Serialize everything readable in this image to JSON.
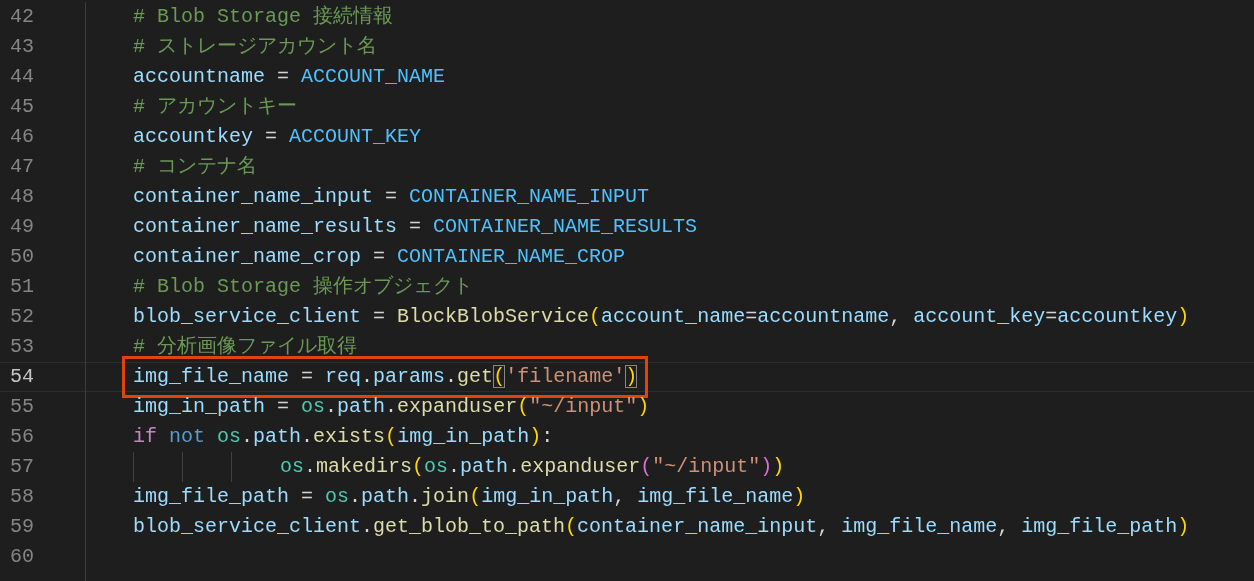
{
  "editor": {
    "lines": [
      {
        "number": "42",
        "current": false,
        "boxed": false,
        "continuation": false,
        "tokens": [
          {
            "kind": "comment",
            "text": "# Blob Storage 接続情報"
          }
        ]
      },
      {
        "number": "43",
        "current": false,
        "boxed": false,
        "continuation": false,
        "tokens": [
          {
            "kind": "comment",
            "text": "# ストレージアカウント名"
          }
        ]
      },
      {
        "number": "44",
        "current": false,
        "boxed": false,
        "continuation": false,
        "tokens": [
          {
            "kind": "var",
            "text": "accountname"
          },
          {
            "kind": "op",
            "text": " = "
          },
          {
            "kind": "const",
            "text": "ACCOUNT_NAME"
          }
        ]
      },
      {
        "number": "45",
        "current": false,
        "boxed": false,
        "continuation": false,
        "tokens": [
          {
            "kind": "comment",
            "text": "# アカウントキー"
          }
        ]
      },
      {
        "number": "46",
        "current": false,
        "boxed": false,
        "continuation": false,
        "tokens": [
          {
            "kind": "var",
            "text": "accountkey"
          },
          {
            "kind": "op",
            "text": " = "
          },
          {
            "kind": "const",
            "text": "ACCOUNT_KEY"
          }
        ]
      },
      {
        "number": "47",
        "current": false,
        "boxed": false,
        "continuation": false,
        "tokens": [
          {
            "kind": "comment",
            "text": "# コンテナ名"
          }
        ]
      },
      {
        "number": "48",
        "current": false,
        "boxed": false,
        "continuation": false,
        "tokens": [
          {
            "kind": "var",
            "text": "container_name_input"
          },
          {
            "kind": "op",
            "text": " = "
          },
          {
            "kind": "const",
            "text": "CONTAINER_NAME_INPUT"
          }
        ]
      },
      {
        "number": "49",
        "current": false,
        "boxed": false,
        "continuation": false,
        "tokens": [
          {
            "kind": "var",
            "text": "container_name_results"
          },
          {
            "kind": "op",
            "text": " = "
          },
          {
            "kind": "const",
            "text": "CONTAINER_NAME_RESULTS"
          }
        ]
      },
      {
        "number": "50",
        "current": false,
        "boxed": false,
        "continuation": false,
        "tokens": [
          {
            "kind": "var",
            "text": "container_name_crop"
          },
          {
            "kind": "op",
            "text": " = "
          },
          {
            "kind": "const",
            "text": "CONTAINER_NAME_CROP"
          }
        ]
      },
      {
        "number": "51",
        "current": false,
        "boxed": false,
        "continuation": false,
        "tokens": [
          {
            "kind": "comment",
            "text": "# Blob Storage 操作オブジェクト"
          }
        ]
      },
      {
        "number": "52",
        "current": false,
        "boxed": false,
        "continuation": false,
        "tokens": [
          {
            "kind": "var",
            "text": "blob_service_client"
          },
          {
            "kind": "op",
            "text": " = "
          },
          {
            "kind": "func",
            "text": "BlockBlobService"
          },
          {
            "kind": "bracket1",
            "text": "("
          },
          {
            "kind": "var",
            "text": "account_name"
          },
          {
            "kind": "op",
            "text": "="
          },
          {
            "kind": "var",
            "text": "accountname"
          },
          {
            "kind": "op",
            "text": ", "
          },
          {
            "kind": "var",
            "text": "account_key"
          },
          {
            "kind": "op",
            "text": "="
          },
          {
            "kind": "var",
            "text": "accountkey"
          },
          {
            "kind": "bracket1",
            "text": ")"
          }
        ]
      },
      {
        "number": "53",
        "current": false,
        "boxed": false,
        "continuation": false,
        "tokens": [
          {
            "kind": "comment",
            "text": "# 分析画像ファイル取得"
          }
        ]
      },
      {
        "number": "54",
        "current": true,
        "boxed": true,
        "continuation": false,
        "tokens": [
          {
            "kind": "var",
            "text": "img_file_name"
          },
          {
            "kind": "op",
            "text": " = "
          },
          {
            "kind": "var",
            "text": "req"
          },
          {
            "kind": "op",
            "text": "."
          },
          {
            "kind": "var",
            "text": "params"
          },
          {
            "kind": "op",
            "text": "."
          },
          {
            "kind": "func",
            "text": "get"
          },
          {
            "kind": "bracket_match",
            "text": "("
          },
          {
            "kind": "string",
            "text": "'filename'"
          },
          {
            "kind": "bracket_match",
            "text": ")"
          }
        ]
      },
      {
        "number": "55",
        "current": false,
        "boxed": false,
        "continuation": false,
        "tokens": [
          {
            "kind": "var",
            "text": "img_in_path"
          },
          {
            "kind": "op",
            "text": " = "
          },
          {
            "kind": "class",
            "text": "os"
          },
          {
            "kind": "op",
            "text": "."
          },
          {
            "kind": "var",
            "text": "path"
          },
          {
            "kind": "op",
            "text": "."
          },
          {
            "kind": "func",
            "text": "expanduser"
          },
          {
            "kind": "bracket1",
            "text": "("
          },
          {
            "kind": "string",
            "text": "\"~/input\""
          },
          {
            "kind": "bracket1",
            "text": ")"
          }
        ]
      },
      {
        "number": "56",
        "current": false,
        "boxed": false,
        "continuation": false,
        "tokens": [
          {
            "kind": "control",
            "text": "if "
          },
          {
            "kind": "keyword",
            "text": "not "
          },
          {
            "kind": "class",
            "text": "os"
          },
          {
            "kind": "op",
            "text": "."
          },
          {
            "kind": "var",
            "text": "path"
          },
          {
            "kind": "op",
            "text": "."
          },
          {
            "kind": "func",
            "text": "exists"
          },
          {
            "kind": "bracket1",
            "text": "("
          },
          {
            "kind": "var",
            "text": "img_in_path"
          },
          {
            "kind": "bracket1",
            "text": ")"
          },
          {
            "kind": "op",
            "text": ":"
          }
        ]
      },
      {
        "number": "57",
        "current": false,
        "boxed": false,
        "continuation": true,
        "tokens": [
          {
            "kind": "class",
            "text": "os"
          },
          {
            "kind": "op",
            "text": "."
          },
          {
            "kind": "func",
            "text": "makedirs"
          },
          {
            "kind": "bracket1",
            "text": "("
          },
          {
            "kind": "class",
            "text": "os"
          },
          {
            "kind": "op",
            "text": "."
          },
          {
            "kind": "var",
            "text": "path"
          },
          {
            "kind": "op",
            "text": "."
          },
          {
            "kind": "func",
            "text": "expanduser"
          },
          {
            "kind": "bracket2",
            "text": "("
          },
          {
            "kind": "string",
            "text": "\"~/input\""
          },
          {
            "kind": "bracket2",
            "text": ")"
          },
          {
            "kind": "bracket1",
            "text": ")"
          }
        ]
      },
      {
        "number": "58",
        "current": false,
        "boxed": false,
        "continuation": false,
        "tokens": [
          {
            "kind": "var",
            "text": "img_file_path"
          },
          {
            "kind": "op",
            "text": " = "
          },
          {
            "kind": "class",
            "text": "os"
          },
          {
            "kind": "op",
            "text": "."
          },
          {
            "kind": "var",
            "text": "path"
          },
          {
            "kind": "op",
            "text": "."
          },
          {
            "kind": "func",
            "text": "join"
          },
          {
            "kind": "bracket1",
            "text": "("
          },
          {
            "kind": "var",
            "text": "img_in_path"
          },
          {
            "kind": "op",
            "text": ", "
          },
          {
            "kind": "var",
            "text": "img_file_name"
          },
          {
            "kind": "bracket1",
            "text": ")"
          }
        ]
      },
      {
        "number": "59",
        "current": false,
        "boxed": false,
        "continuation": false,
        "tokens": [
          {
            "kind": "var",
            "text": "blob_service_client"
          },
          {
            "kind": "op",
            "text": "."
          },
          {
            "kind": "func",
            "text": "get_blob_to_path"
          },
          {
            "kind": "bracket1",
            "text": "("
          },
          {
            "kind": "var",
            "text": "container_name_input"
          },
          {
            "kind": "op",
            "text": ", "
          },
          {
            "kind": "var",
            "text": "img_file_name"
          },
          {
            "kind": "op",
            "text": ", "
          },
          {
            "kind": "var",
            "text": "img_file_path"
          },
          {
            "kind": "bracket1",
            "text": ")"
          }
        ]
      },
      {
        "number": "60",
        "current": false,
        "boxed": false,
        "continuation": false
      }
    ]
  }
}
